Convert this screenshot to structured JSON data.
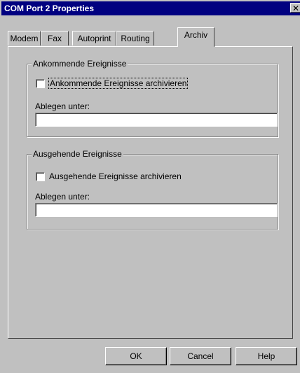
{
  "window": {
    "title": "COM Port 2 Properties",
    "close_label": "✕"
  },
  "tabs": [
    {
      "label": "Modem",
      "active": false
    },
    {
      "label": "Fax",
      "active": false
    },
    {
      "label": "Autoprint",
      "active": false
    },
    {
      "label": "Routing",
      "active": false
    },
    {
      "label": "Archiv",
      "active": true
    }
  ],
  "incoming": {
    "group_label": "Ankommende Ereignisse",
    "checkbox_label": "Ankommende Ereignisse archivieren",
    "checked": false,
    "path_label": "Ablegen unter:",
    "path_value": ""
  },
  "outgoing": {
    "group_label": "Ausgehende Ereignisse",
    "checkbox_label": "Ausgehende Ereignisse archivieren",
    "checked": false,
    "path_label": "Ablegen unter:",
    "path_value": ""
  },
  "buttons": {
    "ok": "OK",
    "cancel": "Cancel",
    "help": "Help"
  }
}
